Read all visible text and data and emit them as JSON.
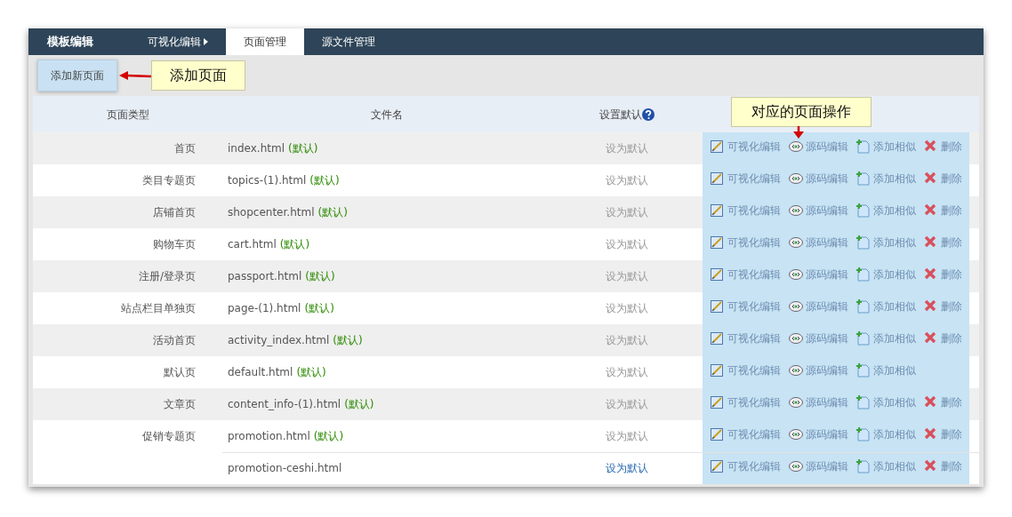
{
  "nav": {
    "brand": "模板编辑",
    "tabs": [
      {
        "label": "可视化编辑",
        "selected": false,
        "has_menu": true
      },
      {
        "label": "页面管理",
        "selected": true,
        "has_menu": false
      },
      {
        "label": "源文件管理",
        "selected": false,
        "has_menu": false
      }
    ]
  },
  "toolbar": {
    "add_button": "添加新页面",
    "callout": "添加页面"
  },
  "table": {
    "columns": [
      "页面类型",
      "文件名",
      "设置默认"
    ],
    "callout": "对应的页面操作",
    "groups": [
      {
        "type": "首页",
        "files": [
          {
            "name": "index.html",
            "tag": "(默认)",
            "set_default": "设为默认",
            "set_default_enabled": false,
            "actions": [
              {
                "kind": "visual",
                "label": "可视化编辑"
              },
              {
                "kind": "source",
                "label": "源码编辑"
              },
              {
                "kind": "copy",
                "label": "添加相似"
              },
              {
                "kind": "delete",
                "label": "删除"
              }
            ]
          }
        ]
      },
      {
        "type": "类目专题页",
        "files": [
          {
            "name": "topics-(1).html",
            "tag": "(默认)",
            "set_default": "设为默认",
            "set_default_enabled": false,
            "actions": [
              {
                "kind": "visual",
                "label": "可视化编辑"
              },
              {
                "kind": "source",
                "label": "源码编辑"
              },
              {
                "kind": "copy",
                "label": "添加相似"
              },
              {
                "kind": "delete",
                "label": "删除"
              }
            ]
          }
        ]
      },
      {
        "type": "店铺首页",
        "files": [
          {
            "name": "shopcenter.html",
            "tag": "(默认)",
            "set_default": "设为默认",
            "set_default_enabled": false,
            "actions": [
              {
                "kind": "visual",
                "label": "可视化编辑"
              },
              {
                "kind": "source",
                "label": "源码编辑"
              },
              {
                "kind": "copy",
                "label": "添加相似"
              },
              {
                "kind": "delete",
                "label": "删除"
              }
            ]
          }
        ]
      },
      {
        "type": "购物车页",
        "files": [
          {
            "name": "cart.html",
            "tag": "(默认)",
            "set_default": "设为默认",
            "set_default_enabled": false,
            "actions": [
              {
                "kind": "visual",
                "label": "可视化编辑"
              },
              {
                "kind": "source",
                "label": "源码编辑"
              },
              {
                "kind": "copy",
                "label": "添加相似"
              },
              {
                "kind": "delete",
                "label": "删除"
              }
            ]
          }
        ]
      },
      {
        "type": "注册/登录页",
        "files": [
          {
            "name": "passport.html",
            "tag": "(默认)",
            "set_default": "设为默认",
            "set_default_enabled": false,
            "actions": [
              {
                "kind": "visual",
                "label": "可视化编辑"
              },
              {
                "kind": "source",
                "label": "源码编辑"
              },
              {
                "kind": "copy",
                "label": "添加相似"
              },
              {
                "kind": "delete",
                "label": "删除"
              }
            ]
          }
        ]
      },
      {
        "type": "站点栏目单独页",
        "files": [
          {
            "name": "page-(1).html",
            "tag": "(默认)",
            "set_default": "设为默认",
            "set_default_enabled": false,
            "actions": [
              {
                "kind": "visual",
                "label": "可视化编辑"
              },
              {
                "kind": "source",
                "label": "源码编辑"
              },
              {
                "kind": "copy",
                "label": "添加相似"
              },
              {
                "kind": "delete",
                "label": "删除"
              }
            ]
          }
        ]
      },
      {
        "type": "活动首页",
        "files": [
          {
            "name": "activity_index.html",
            "tag": "(默认)",
            "set_default": "设为默认",
            "set_default_enabled": false,
            "actions": [
              {
                "kind": "visual",
                "label": "可视化编辑"
              },
              {
                "kind": "source",
                "label": "源码编辑"
              },
              {
                "kind": "copy",
                "label": "添加相似"
              },
              {
                "kind": "delete",
                "label": "删除"
              }
            ]
          }
        ]
      },
      {
        "type": "默认页",
        "files": [
          {
            "name": "default.html",
            "tag": "(默认)",
            "set_default": "设为默认",
            "set_default_enabled": false,
            "actions": [
              {
                "kind": "visual",
                "label": "可视化编辑"
              },
              {
                "kind": "source",
                "label": "源码编辑"
              },
              {
                "kind": "copy",
                "label": "添加相似"
              }
            ]
          }
        ]
      },
      {
        "type": "文章页",
        "files": [
          {
            "name": "content_info-(1).html",
            "tag": "(默认)",
            "set_default": "设为默认",
            "set_default_enabled": false,
            "actions": [
              {
                "kind": "visual",
                "label": "可视化编辑"
              },
              {
                "kind": "source",
                "label": "源码编辑"
              },
              {
                "kind": "copy",
                "label": "添加相似"
              },
              {
                "kind": "delete",
                "label": "删除"
              }
            ]
          }
        ]
      },
      {
        "type": "促销专题页",
        "files": [
          {
            "name": "promotion.html",
            "tag": "(默认)",
            "set_default": "设为默认",
            "set_default_enabled": false,
            "actions": [
              {
                "kind": "visual",
                "label": "可视化编辑"
              },
              {
                "kind": "source",
                "label": "源码编辑"
              },
              {
                "kind": "copy",
                "label": "添加相似"
              },
              {
                "kind": "delete",
                "label": "删除"
              }
            ]
          },
          {
            "name": "promotion-ceshi.html",
            "set_default": "设为默认",
            "set_default_enabled": true,
            "actions": [
              {
                "kind": "visual",
                "label": "可视化编辑"
              },
              {
                "kind": "source",
                "label": "源码编辑"
              },
              {
                "kind": "copy",
                "label": "添加相似"
              },
              {
                "kind": "delete",
                "label": "删除"
              }
            ]
          }
        ]
      }
    ]
  }
}
